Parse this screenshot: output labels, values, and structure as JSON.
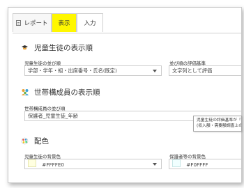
{
  "tabs": [
    {
      "label": "レポート",
      "icon": "report-icon"
    },
    {
      "label": "表示"
    },
    {
      "label": "入力"
    }
  ],
  "colors": {
    "active_tab": "#fff700",
    "student_bg_swatch": "#FFFFE0",
    "guardian_bg_swatch": "#F0FFFF"
  },
  "student_order": {
    "title": "児童生徒の表示順",
    "icon": "student-icon",
    "sort_label": "児童生徒の並び順",
    "sort_value": "学部・学年・組・出席番号・氏名(既定)",
    "criteria_label": "並び順の評価基準",
    "criteria_value": "文字列として評価"
  },
  "household_order": {
    "title": "世帯構成員の表示順",
    "icon": "household-icon",
    "sort_label": "世帯構成員の並び順",
    "sort_value": "保護者_児童生徒_年齢"
  },
  "tooltip": {
    "line1": "児童生徒の評価基準が「数",
    "line2": "(収入額・需要額調査上の"
  },
  "color_section": {
    "title": "配色",
    "icon": "palette-icon",
    "student_bg_label": "児童生徒の背景色",
    "student_bg_value": "#FFFFE0",
    "guardian_bg_label": "保護者等の背景色",
    "guardian_bg_value": "#F0FFFF"
  }
}
